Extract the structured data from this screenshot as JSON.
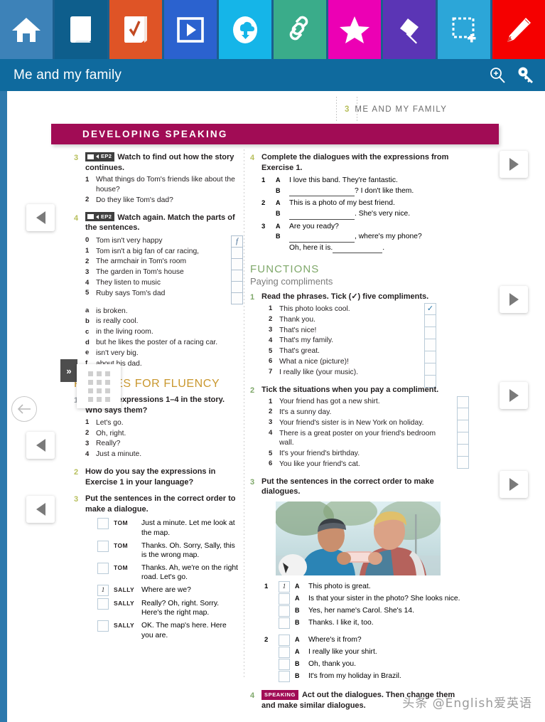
{
  "toolbar": {
    "items": [
      {
        "name": "home-icon",
        "label": "Home",
        "color": "#3d82b8"
      },
      {
        "name": "book-icon",
        "label": "Book",
        "color": "#0e5e8c"
      },
      {
        "name": "workbook-check-icon",
        "label": "Workbook",
        "color": "#df5426"
      },
      {
        "name": "video-play-icon",
        "label": "Video",
        "color": "#2b62cf"
      },
      {
        "name": "cloud-download-icon",
        "label": "Download",
        "color": "#15b5e8"
      },
      {
        "name": "link-icon",
        "label": "Link",
        "color": "#3aac8a"
      },
      {
        "name": "star-icon",
        "label": "Favourites",
        "color": "#ec00b4"
      },
      {
        "name": "pin-icon",
        "label": "Pin",
        "color": "#5b35b5"
      },
      {
        "name": "snapshot-add-icon",
        "label": "Snapshot",
        "color": "#2ca6d8"
      },
      {
        "name": "pencil-icon",
        "label": "Draw",
        "color": "#f50000"
      }
    ]
  },
  "titlebar": {
    "title": "Me and my family",
    "zoom_icon": "zoom-in-icon",
    "key_icon": "key-icon"
  },
  "runhead": {
    "unit": "3",
    "text": "ME AND MY FAMILY"
  },
  "band": {
    "label": "DEVELOPING SPEAKING"
  },
  "left_column": {
    "ex3": {
      "num": "3",
      "badge": "EP2",
      "head": "Watch to find out how the story continues.",
      "items": [
        {
          "n": "1",
          "t": "What things do Tom's friends like about the house?"
        },
        {
          "n": "2",
          "t": "Do they like Tom's dad?"
        }
      ]
    },
    "ex4": {
      "num": "4",
      "badge": "EP2",
      "head": "Watch again. Match the parts of the sentences.",
      "stems": [
        {
          "n": "0",
          "t": "Tom isn't very happy",
          "answer": "f"
        },
        {
          "n": "1",
          "t": "Tom isn't a big fan of car racing,",
          "answer": ""
        },
        {
          "n": "2",
          "t": "The armchair in Tom's room",
          "answer": ""
        },
        {
          "n": "3",
          "t": "The garden in Tom's house",
          "answer": ""
        },
        {
          "n": "4",
          "t": "They listen to music",
          "answer": ""
        },
        {
          "n": "5",
          "t": "Ruby says Tom's dad",
          "answer": ""
        }
      ],
      "endings": [
        {
          "n": "a",
          "t": "is broken."
        },
        {
          "n": "b",
          "t": "is really cool."
        },
        {
          "n": "c",
          "t": "in the living room."
        },
        {
          "n": "d",
          "t": "but he likes the poster of a racing car."
        },
        {
          "n": "e",
          "t": "isn't very big."
        },
        {
          "n": "f",
          "t": "about his dad."
        }
      ]
    },
    "fluency": {
      "heading": "PHRASES FOR FLUENCY",
      "ex1": {
        "num": "1",
        "head": "Find the expressions 1–4 in the story. Who says them?",
        "items": [
          {
            "n": "1",
            "t": "Let's go."
          },
          {
            "n": "2",
            "t": "Oh, right."
          },
          {
            "n": "3",
            "t": "Really?"
          },
          {
            "n": "4",
            "t": "Just a minute."
          }
        ]
      },
      "ex2": {
        "num": "2",
        "head": "How do you say the expressions in Exercise 1 in your language?"
      },
      "ex3": {
        "num": "3",
        "head": "Put the sentences in the correct order to make a dialogue.",
        "lines": [
          {
            "box": "",
            "who": "TOM",
            "t": "Just a minute. Let me look at the map."
          },
          {
            "box": "",
            "who": "TOM",
            "t": "Thanks. Oh. Sorry, Sally, this is the wrong map."
          },
          {
            "box": "",
            "who": "TOM",
            "t": "Thanks. Ah, we're on the right road. Let's go."
          },
          {
            "box": "1",
            "who": "SALLY",
            "t": "Where are we?"
          },
          {
            "box": "",
            "who": "SALLY",
            "t": "Really? Oh, right. Sorry. Here's the right map."
          },
          {
            "box": "",
            "who": "SALLY",
            "t": "OK. The map's here. Here you are."
          }
        ]
      }
    }
  },
  "right_column": {
    "ex4": {
      "num": "4",
      "head": "Complete the dialogues with the expressions from Exercise 1.",
      "dialogues": [
        {
          "n": "1",
          "lines": [
            {
              "sp": "A",
              "pre": "I love this band. They're fantastic.",
              "gap": false
            },
            {
              "sp": "B",
              "pre": "",
              "gap": true,
              "post": "? I don't like them."
            }
          ]
        },
        {
          "n": "2",
          "lines": [
            {
              "sp": "A",
              "pre": "This is a photo of my best friend.",
              "gap": false
            },
            {
              "sp": "B",
              "pre": "",
              "gap": true,
              "post": ". She's very nice."
            }
          ]
        },
        {
          "n": "3",
          "lines": [
            {
              "sp": "A",
              "pre": "Are you ready?",
              "gap": false
            },
            {
              "sp": "B",
              "pre": "",
              "gap": true,
              "post": ", where's my phone?"
            },
            {
              "sp": "",
              "pre": "Oh, here it is.",
              "gap": true,
              "post": "."
            }
          ]
        }
      ]
    },
    "functions": {
      "heading": "FUNCTIONS",
      "subheading": "Paying compliments",
      "ex1": {
        "num": "1",
        "head": "Read the phrases. Tick (✓) five compliments.",
        "items": [
          {
            "n": "1",
            "t": "This photo looks cool.",
            "tick": "✓"
          },
          {
            "n": "2",
            "t": "Thank you.",
            "tick": ""
          },
          {
            "n": "3",
            "t": "That's nice!",
            "tick": ""
          },
          {
            "n": "4",
            "t": "That's my family.",
            "tick": ""
          },
          {
            "n": "5",
            "t": "That's great.",
            "tick": ""
          },
          {
            "n": "6",
            "t": "What a nice (picture)!",
            "tick": ""
          },
          {
            "n": "7",
            "t": "I really like (your music).",
            "tick": ""
          }
        ]
      },
      "ex2": {
        "num": "2",
        "head": "Tick the situations when you pay a compliment.",
        "items": [
          {
            "n": "1",
            "t": "Your friend has got a new shirt.",
            "tick": ""
          },
          {
            "n": "2",
            "t": "It's a sunny day.",
            "tick": ""
          },
          {
            "n": "3",
            "t": "Your friend's sister is in New York on holiday.",
            "tick": ""
          },
          {
            "n": "4",
            "t": "There is a great poster on your friend's bedroom wall.",
            "tick": ""
          },
          {
            "n": "5",
            "t": "It's your friend's birthday.",
            "tick": ""
          },
          {
            "n": "6",
            "t": "You like your friend's cat.",
            "tick": ""
          }
        ]
      },
      "ex3": {
        "num": "3",
        "head": "Put the sentences in the correct order to make dialogues.",
        "photo_alt": "two-teenage-boys-looking-at-phone",
        "groups": [
          {
            "idx": "1",
            "lines": [
              {
                "box": "1",
                "sp": "A",
                "t": "This photo is great."
              },
              {
                "box": "",
                "sp": "A",
                "t": "Is that your sister in the photo? She looks nice."
              },
              {
                "box": "",
                "sp": "B",
                "t": "Yes, her name's Carol. She's 14."
              },
              {
                "box": "",
                "sp": "B",
                "t": "Thanks. I like it, too."
              }
            ]
          },
          {
            "idx": "2",
            "lines": [
              {
                "box": "",
                "sp": "A",
                "t": "Where's it from?"
              },
              {
                "box": "",
                "sp": "A",
                "t": "I really like your shirt."
              },
              {
                "box": "",
                "sp": "B",
                "t": "Oh, thank you."
              },
              {
                "box": "",
                "sp": "B",
                "t": "It's from my holiday in Brazil."
              }
            ]
          }
        ]
      },
      "ex4": {
        "num": "4",
        "badge": "SPEAKING",
        "head": "Act out the dialogues. Then change them and make similar dialogues."
      }
    }
  },
  "overlay": {
    "tab_label": "»",
    "name": "thumbnail-grid-panel"
  },
  "nav": {
    "prev_label": "◀",
    "next_label": "▶",
    "back_label": "←"
  },
  "watermark": {
    "text": "头条 @English爱英语"
  },
  "colors": {
    "band": "#a10c55",
    "functions": "#7fa86a",
    "fluency": "#c9972e",
    "exnum": "#b7bf5c",
    "titlebar": "#0f6a9e"
  }
}
